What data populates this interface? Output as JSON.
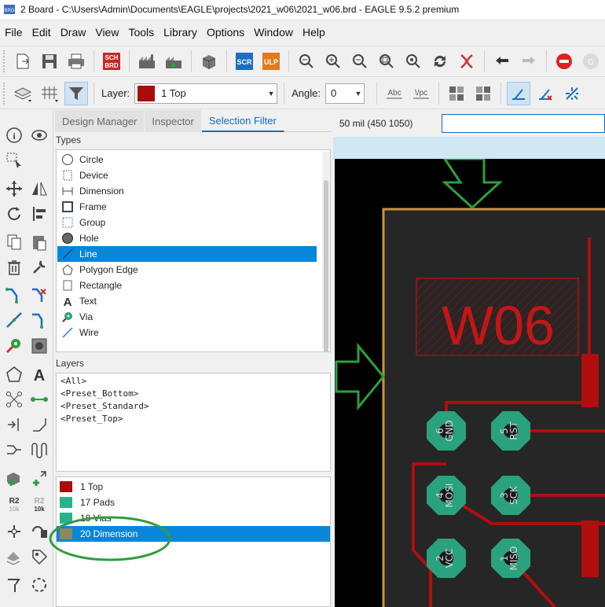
{
  "window": {
    "title": "2 Board - C:\\Users\\Admin\\Documents\\EAGLE\\projects\\2021_w06\\2021_w06.brd - EAGLE 9.5.2 premium",
    "app_icon": "eagle-board-icon"
  },
  "menu": [
    "File",
    "Edit",
    "Draw",
    "View",
    "Tools",
    "Library",
    "Options",
    "Window",
    "Help"
  ],
  "toolbar": {
    "layer_label": "Layer:",
    "layer_value": "1 Top",
    "layer_color": "#a80c0c",
    "angle_label": "Angle:",
    "angle_value": "0",
    "scr_label": "SCR",
    "ulp_label": "ULP",
    "sch_label": "SCH",
    "brd_label": "BRD",
    "abc_label": "Abc",
    "vpc_label": "\\/pc"
  },
  "left_tools": {
    "r2_label": "R2",
    "r2_sub": "10k"
  },
  "panel": {
    "tabs": [
      "Design Manager",
      "Inspector",
      "Selection Filter"
    ],
    "active_tab": "Selection Filter",
    "types_title": "Types",
    "types": [
      {
        "label": "Circle",
        "icon": "circle-icon"
      },
      {
        "label": "Device",
        "icon": "device-icon"
      },
      {
        "label": "Dimension",
        "icon": "dimension-icon"
      },
      {
        "label": "Frame",
        "icon": "frame-icon"
      },
      {
        "label": "Group",
        "icon": "group-icon"
      },
      {
        "label": "Hole",
        "icon": "hole-icon"
      },
      {
        "label": "Line",
        "icon": "line-icon",
        "selected": true
      },
      {
        "label": "Polygon Edge",
        "icon": "polygon-icon"
      },
      {
        "label": "Rectangle",
        "icon": "rectangle-icon"
      },
      {
        "label": "Text",
        "icon": "text-icon"
      },
      {
        "label": "Via",
        "icon": "via-icon"
      },
      {
        "label": "Wire",
        "icon": "wire-icon"
      }
    ],
    "layers_title": "Layers",
    "presets": [
      "<All>",
      "<Preset_Bottom>",
      "<Preset_Standard>",
      "<Preset_Top>"
    ],
    "layer_list": [
      {
        "label": "1 Top",
        "color": "#a80c0c"
      },
      {
        "label": "17 Pads",
        "color": "#26b38a"
      },
      {
        "label": "18 Vias",
        "color": "#26b38a"
      },
      {
        "label": "20 Dimension",
        "color": "#8c8a5a",
        "selected": true
      }
    ]
  },
  "canvas": {
    "coordinate_readout": "50 mil (450 1050)",
    "board_label": "W06",
    "pads": [
      {
        "num": "6",
        "name": "GND"
      },
      {
        "num": "5",
        "name": "RST"
      },
      {
        "num": "4",
        "name": "MOSI"
      },
      {
        "num": "3",
        "name": "SCK"
      },
      {
        "num": "2",
        "name": "VCC"
      },
      {
        "num": "1",
        "name": "MISO"
      }
    ],
    "colors": {
      "background": "#000000",
      "board": "#262626",
      "outline": "#c8963c",
      "trace": "#b10e0e",
      "pad": "#2aa27d",
      "annotation": "#2f9e3c"
    }
  }
}
